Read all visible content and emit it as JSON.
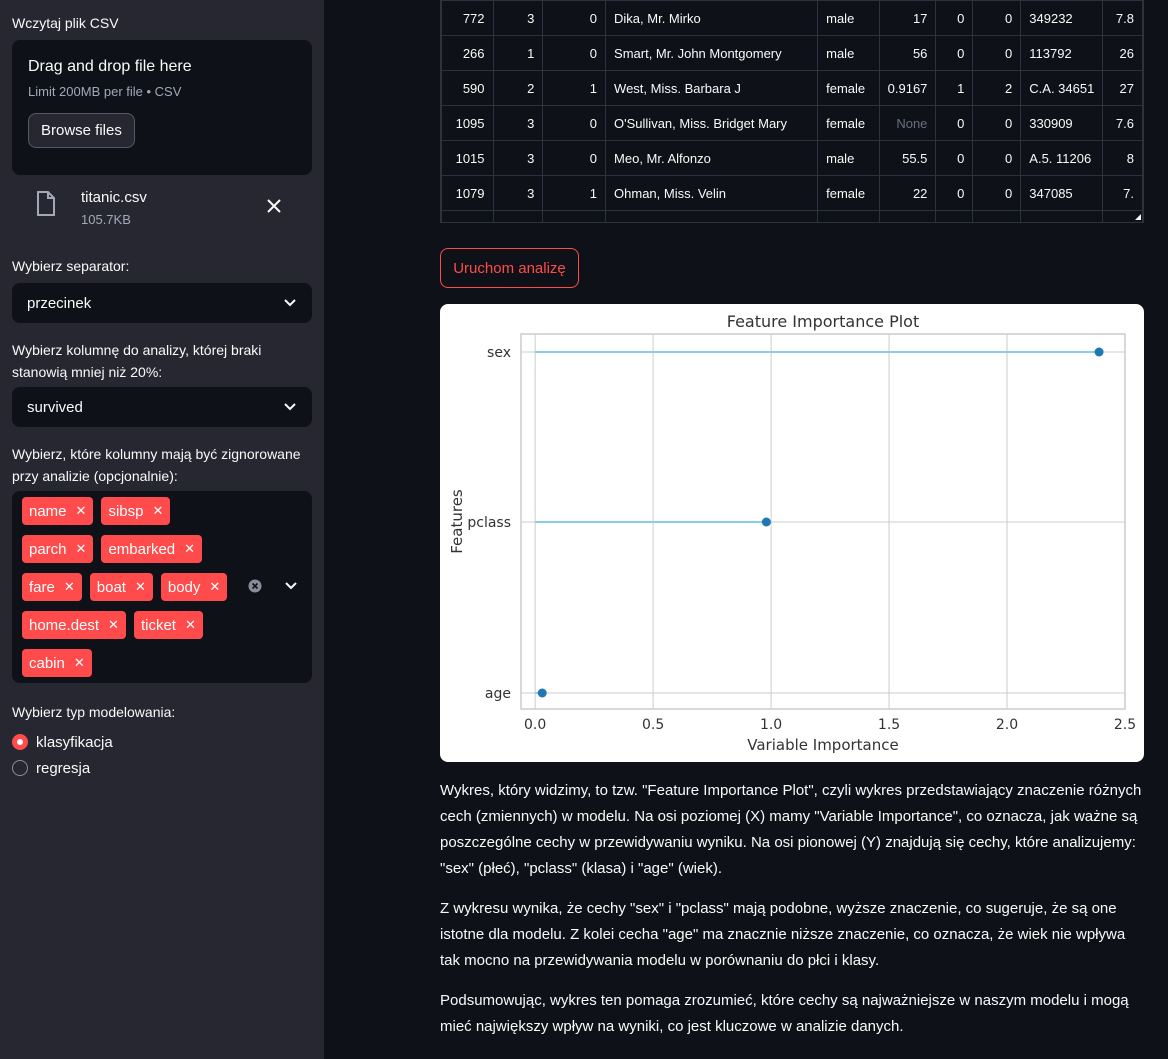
{
  "sidebar": {
    "upload_label": "Wczytaj plik CSV",
    "drop_title": "Drag and drop file here",
    "drop_limit": "Limit 200MB per file • CSV",
    "browse_label": "Browse files",
    "file_name": "titanic.csv",
    "file_size": "105.7KB",
    "separator_label": "Wybierz separator:",
    "separator_value": "przecinek",
    "column_label": "Wybierz kolumnę do analizy, której braki stanowią mniej niż 20%:",
    "column_value": "survived",
    "ignore_label": "Wybierz, które kolumny mają być zignorowane przy analizie (opcjonalnie):",
    "ignored": [
      "name",
      "sibsp",
      "parch",
      "embarked",
      "fare",
      "boat",
      "body",
      "home.dest",
      "ticket",
      "cabin"
    ],
    "model_label": "Wybierz typ modelowania:",
    "model_options": [
      "klasyfikacja",
      "regresja"
    ],
    "model_selected": "klasyfikacja"
  },
  "table": {
    "rows": [
      [
        "772",
        "3",
        "0",
        "Dika, Mr. Mirko",
        "male",
        "17",
        "0",
        "0",
        "349232",
        "7.8"
      ],
      [
        "266",
        "1",
        "0",
        "Smart, Mr. John Montgomery",
        "male",
        "56",
        "0",
        "0",
        "113792",
        "26"
      ],
      [
        "590",
        "2",
        "1",
        "West, Miss. Barbara J",
        "female",
        "0.9167",
        "1",
        "2",
        "C.A. 34651",
        "27"
      ],
      [
        "1095",
        "3",
        "0",
        "O'Sullivan, Miss. Bridget Mary",
        "female",
        "None",
        "0",
        "0",
        "330909",
        "7.6"
      ],
      [
        "1015",
        "3",
        "0",
        "Meo, Mr. Alfonzo",
        "male",
        "55.5",
        "0",
        "0",
        "A.5. 11206",
        "8"
      ],
      [
        "1079",
        "3",
        "1",
        "Ohman, Miss. Velin",
        "female",
        "22",
        "0",
        "0",
        "347085",
        "7."
      ]
    ]
  },
  "run_button": "Uruchom analizę",
  "chart_data": {
    "type": "scatter",
    "title": "Feature Importance Plot",
    "xlabel": "Variable Importance",
    "ylabel": "Features",
    "categories": [
      "sex",
      "pclass",
      "age"
    ],
    "values": [
      2.39,
      0.98,
      0.03
    ],
    "xlim": [
      -0.06,
      2.5
    ],
    "xticks": [
      "0.0",
      "0.5",
      "1.0",
      "1.5",
      "2.0",
      "2.5"
    ],
    "grid": true,
    "colors": {
      "point": "#1f77b4",
      "stem": "#87ceeb"
    }
  },
  "description": [
    "Wykres, który widzimy, to tzw. \"Feature Importance Plot\", czyli wykres przedstawiający znaczenie różnych cech (zmiennych) w modelu. Na osi poziomej (X) mamy \"Variable Importance\", co oznacza, jak ważne są poszczególne cechy w przewidywaniu wyniku. Na osi pionowej (Y) znajdują się cechy, które analizujemy: \"sex\" (płeć), \"pclass\" (klasa) i \"age\" (wiek).",
    "Z wykresu wynika, że cechy \"sex\" i \"pclass\" mają podobne, wyższe znaczenie, co sugeruje, że są one istotne dla modelu. Z kolei cecha \"age\" ma znacznie niższe znaczenie, co oznacza, że wiek nie wpływa tak mocno na przewidywania modelu w porównaniu do płci i klasy.",
    "Podsumowując, wykres ten pomaga zrozumieć, które cechy są najważniejsze w naszym modelu i mogą mieć największy wpływ na wyniki, co jest kluczowe w analizie danych."
  ]
}
